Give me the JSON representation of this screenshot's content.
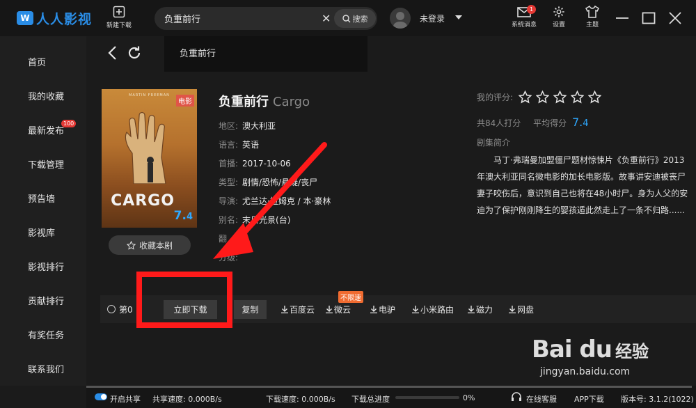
{
  "app": {
    "logo_text": "人人影视",
    "logo_mark": "W",
    "new_download": "新建下载",
    "search_value": "负重前行",
    "search_button": "搜索",
    "login_text": "未登录",
    "tools": [
      {
        "label": "系统消息",
        "icon": "mail-icon",
        "badge": "1"
      },
      {
        "label": "设置",
        "icon": "gear-icon"
      },
      {
        "label": "主题",
        "icon": "shirt-icon"
      }
    ]
  },
  "sidebar": {
    "items": [
      {
        "label": "首页"
      },
      {
        "label": "我的收藏"
      },
      {
        "label": "最新发布",
        "badge": "100"
      },
      {
        "label": "下载管理"
      },
      {
        "label": "预告墙"
      },
      {
        "label": "影视库"
      },
      {
        "label": "影视排行"
      },
      {
        "label": "贡献排行"
      },
      {
        "label": "有奖任务"
      },
      {
        "label": "联系我们"
      }
    ]
  },
  "breadcrumb": {
    "popup_text": "负重前行"
  },
  "poster": {
    "top_text": "MARTIN FREEMAN",
    "title": "CARGO",
    "type_tag": "电影",
    "score": "7.",
    "score_small": "4"
  },
  "favorite_label": "收藏本剧",
  "movie": {
    "title_cn": "负重前行",
    "title_en": "Cargo",
    "info": [
      {
        "k": "地区:",
        "v": "澳大利亚"
      },
      {
        "k": "语言:",
        "v": "英语"
      },
      {
        "k": "首播:",
        "v": "2017-10-06"
      },
      {
        "k": "类型:",
        "v": "剧情/恐怖/悬疑/丧尸"
      },
      {
        "k": "导演:",
        "v": "尤兰达·拉姆克 / 本·豪林"
      },
      {
        "k": "别名:",
        "v": "末日光景(台)"
      },
      {
        "k": "翻",
        "v": ""
      },
      {
        "k": "分级:",
        "v": ""
      }
    ]
  },
  "rating": {
    "my_rating_label": "我的评分:",
    "stars_filled": 0,
    "stars_total": 5,
    "count_text": "共84人打分",
    "avg_label": "平均得分",
    "avg_score": "7.",
    "avg_score_small": "4"
  },
  "synopsis": {
    "heading": "剧集简介",
    "text": "马丁·弗瑞曼加盟僵尸题材惊悚片《负重前行》2013年澳大利亚同名微电影的加长电影版。故事讲安迪被丧尸妻子咬伤后，意识到自己也将在48小时尸。身为人父的安迪为了保护刚刚降生的婴孩遁此然走上了一条不归路......"
  },
  "download_row": {
    "episode": "第0",
    "download_now": "立即下载",
    "copy": "复制",
    "unlimited_tag": "不限速",
    "sources": [
      "百度云",
      "微云",
      "电驴",
      "小米路由",
      "磁力",
      "网盘"
    ]
  },
  "watermark": {
    "logo": "Bai du",
    "cn": "经验",
    "url": "jingyan.baidu.com"
  },
  "status": {
    "share": "开启共享",
    "share_speed": "共享速度: 0.000B/s",
    "download_speed": "下载速度: 0.000B/s",
    "total_progress_label": "下载总进度",
    "total_progress_percent": "0%",
    "progress_value": 0,
    "service": "在线客服",
    "app_download": "APP下载",
    "version": "版本号: 3.1.2(1022)"
  },
  "colors": {
    "accent": "#2a8de6",
    "score": "#2ea8ff",
    "annotation": "#ff1a1a",
    "badge": "#e53935"
  }
}
